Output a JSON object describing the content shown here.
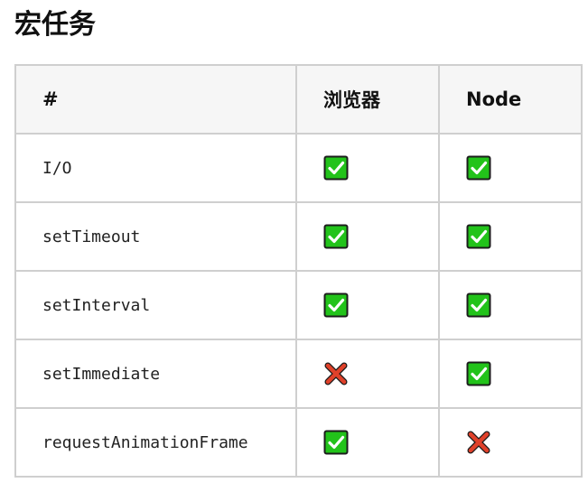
{
  "title": "宏任务",
  "table": {
    "headers": [
      "#",
      "浏览器",
      "Node"
    ],
    "rows": [
      {
        "name": "I/O",
        "browser": true,
        "node": true
      },
      {
        "name": "setTimeout",
        "browser": true,
        "node": true
      },
      {
        "name": "setInterval",
        "browser": true,
        "node": true
      },
      {
        "name": "setImmediate",
        "browser": false,
        "node": true
      },
      {
        "name": "requestAnimationFrame",
        "browser": true,
        "node": false
      }
    ]
  },
  "icons": {
    "supported": "check-box-icon",
    "unsupported": "cross-icon"
  },
  "colors": {
    "check_fill": "#22c31a",
    "check_border": "#1c1c1c",
    "cross": "#e0412a"
  }
}
